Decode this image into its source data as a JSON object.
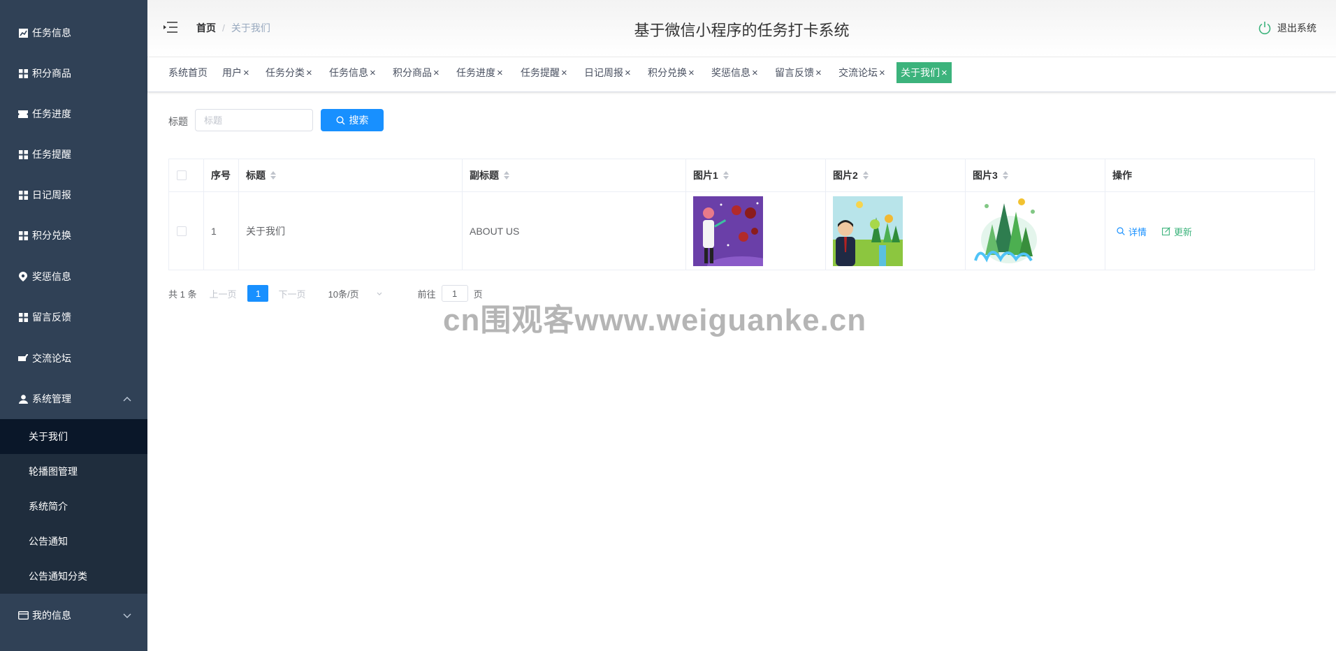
{
  "app": {
    "title": "基于微信小程序的任务打卡系统",
    "logout_label": "退出系统"
  },
  "sidebar": {
    "items": [
      {
        "label": "任务信息",
        "icon": "chart-icon"
      },
      {
        "label": "积分商品",
        "icon": "grid-icon"
      },
      {
        "label": "任务进度",
        "icon": "ticket-icon"
      },
      {
        "label": "任务提醒",
        "icon": "grid-icon"
      },
      {
        "label": "日记周报",
        "icon": "grid-icon"
      },
      {
        "label": "积分兑换",
        "icon": "grid-icon"
      },
      {
        "label": "奖惩信息",
        "icon": "location-icon"
      },
      {
        "label": "留言反馈",
        "icon": "grid-icon"
      },
      {
        "label": "交流论坛",
        "icon": "cart-icon"
      },
      {
        "label": "系统管理",
        "icon": "user-icon"
      }
    ],
    "system_submenu": [
      "关于我们",
      "轮播图管理",
      "系统简介",
      "公告通知",
      "公告通知分类"
    ],
    "my_info": "我的信息"
  },
  "breadcrumb": {
    "home": "首页",
    "separator": "/",
    "current": "关于我们"
  },
  "tags": [
    {
      "label": "系统首页",
      "closable": false
    },
    {
      "label": "用户",
      "closable": true
    },
    {
      "label": "任务分类",
      "closable": true
    },
    {
      "label": "任务信息",
      "closable": true
    },
    {
      "label": "积分商品",
      "closable": true
    },
    {
      "label": "任务进度",
      "closable": true
    },
    {
      "label": "任务提醒",
      "closable": true
    },
    {
      "label": "日记周报",
      "closable": true
    },
    {
      "label": "积分兑换",
      "closable": true
    },
    {
      "label": "奖惩信息",
      "closable": true
    },
    {
      "label": "留言反馈",
      "closable": true
    },
    {
      "label": "交流论坛",
      "closable": true
    },
    {
      "label": "关于我们",
      "closable": true,
      "active": true
    }
  ],
  "tag_close": "×",
  "search": {
    "label": "标题",
    "placeholder": "标题",
    "button": "搜索"
  },
  "table": {
    "headers": [
      "序号",
      "标题",
      "副标题",
      "图片1",
      "图片2",
      "图片3",
      "操作"
    ],
    "rows": [
      {
        "index": "1",
        "title": "关于我们",
        "subtitle": "ABOUT US"
      }
    ],
    "actions": {
      "detail": "详情",
      "update": "更新"
    }
  },
  "pagination": {
    "total": "共 1 条",
    "prev": "上一页",
    "page": "1",
    "next": "下一页",
    "page_size": "10条/页",
    "goto_label": "前往",
    "goto_value": "1",
    "page_unit": "页"
  },
  "watermark": "cn围观客www.weiguanke.cn",
  "colors": {
    "sidebar": "#304156",
    "submenu": "#1f2d3d",
    "primary": "#1890ff",
    "success": "#3cb37c"
  }
}
